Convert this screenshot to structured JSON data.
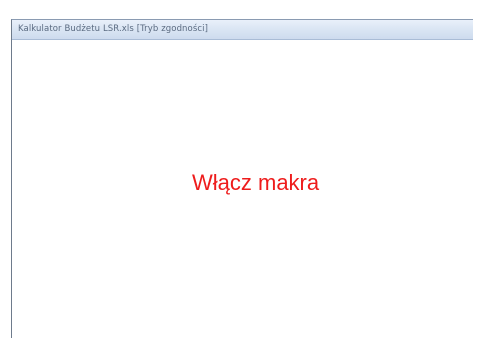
{
  "window": {
    "title": "Kalkulator Budżetu LSR.xls  [Tryb zgodności]"
  },
  "content": {
    "message": "Włącz makra",
    "message_color": "#ee1c1c"
  }
}
